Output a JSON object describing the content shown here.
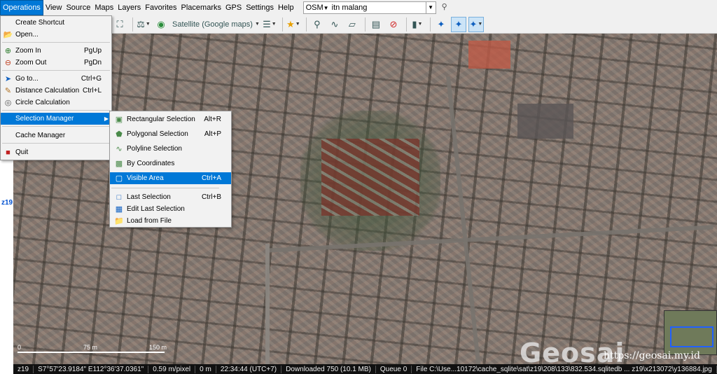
{
  "menubar": {
    "items": [
      "Operations",
      "View",
      "Source",
      "Maps",
      "Layers",
      "Favorites",
      "Placemarks",
      "GPS",
      "Settings",
      "Help"
    ],
    "source_value": "OSM",
    "search_value": "itn malang"
  },
  "toolbar": {
    "map_type_label": "Satellite (Google maps)"
  },
  "zoom_indicator": "z19",
  "operations_menu": {
    "items": [
      {
        "label": "Create Shortcut",
        "shortcut": "",
        "icon": "shortcut-icon"
      },
      {
        "label": "Open...",
        "shortcut": "",
        "icon": "folder-open-icon"
      },
      {
        "label": "Zoom In",
        "shortcut": "PgUp",
        "icon": "zoom-in-icon"
      },
      {
        "label": "Zoom Out",
        "shortcut": "PgDn",
        "icon": "zoom-out-icon"
      },
      {
        "label": "Go to...",
        "shortcut": "Ctrl+G",
        "icon": "goto-icon"
      },
      {
        "label": "Distance Calculation",
        "shortcut": "Ctrl+L",
        "icon": "ruler-icon"
      },
      {
        "label": "Circle Calculation",
        "shortcut": "",
        "icon": "circle-calc-icon"
      },
      {
        "label": "Selection Manager",
        "shortcut": "",
        "icon": ""
      },
      {
        "label": "Cache Manager",
        "shortcut": "",
        "icon": ""
      },
      {
        "label": "Quit",
        "shortcut": "",
        "icon": "quit-icon"
      }
    ]
  },
  "selection_submenu": {
    "items": [
      {
        "label": "Rectangular Selection",
        "shortcut": "Alt+R",
        "icon": "rect-select-icon"
      },
      {
        "label": "Polygonal Selection",
        "shortcut": "Alt+P",
        "icon": "polygon-select-icon"
      },
      {
        "label": "Polyline Selection",
        "shortcut": "",
        "icon": "polyline-select-icon"
      },
      {
        "label": "By Coordinates",
        "shortcut": "",
        "icon": "coordinates-icon"
      },
      {
        "label": "Visible Area",
        "shortcut": "Ctrl+A",
        "icon": "visible-area-icon"
      },
      {
        "label": "Last Selection",
        "shortcut": "Ctrl+B",
        "icon": "last-selection-icon"
      },
      {
        "label": "Edit Last Selection",
        "shortcut": "",
        "icon": "edit-selection-icon"
      },
      {
        "label": "Load from File",
        "shortcut": "",
        "icon": "load-file-icon"
      }
    ]
  },
  "map": {
    "scale_labels": [
      "0",
      "75 m",
      "150 m"
    ],
    "watermark": "Geosai",
    "watermark_url": "https://geosai.my.id"
  },
  "statusbar": {
    "zoom": "z19",
    "coords": "S7°57'23.9184\" E112°36'37.0361\"",
    "resolution": "0.59 m/pixel",
    "altitude": "0 m",
    "time": "22:34:44 (UTC+7)",
    "downloaded": "Downloaded 750 (10.1 MB)",
    "queue": "Queue 0",
    "file": "File C:\\Use...10172\\cache_sqlite\\sat\\z19\\208\\133\\832.534.sqlitedb ... z19\\x213072\\y136884.jpg"
  }
}
